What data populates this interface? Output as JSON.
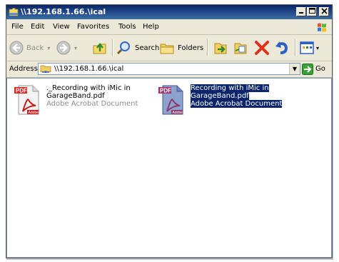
{
  "window": {
    "title": "\\\\192.168.1.66.\\ical",
    "controls": [
      "minimize",
      "maximize",
      "close"
    ]
  },
  "menubar": {
    "items": [
      "File",
      "Edit",
      "View",
      "Favorites",
      "Tools",
      "Help"
    ]
  },
  "toolbar": {
    "back_label": "Back",
    "search_label": "Search",
    "folders_label": "Folders",
    "icons": [
      "back-icon",
      "forward-icon",
      "up-folder-icon",
      "search-icon",
      "folders-icon",
      "move-to-icon",
      "copy-to-icon",
      "delete-icon",
      "undo-icon",
      "views-icon"
    ]
  },
  "address": {
    "label": "Address",
    "value": "\\\\192.168.1.66.\\ical",
    "go_label": "Go"
  },
  "files": [
    {
      "name_lines": [
        "._Recording with iMic in",
        "GarageBand.pdf"
      ],
      "type": "Adobe Acrobat Document",
      "selected": false
    },
    {
      "name_lines": [
        "Recording with iMic in",
        "GarageBand.pdf"
      ],
      "type": "Adobe Acrobat Document",
      "selected": true
    }
  ],
  "colors": {
    "titlebar": "#0a246a",
    "selection": "#0b246a",
    "chrome": "#ece9d8",
    "delete": "#e0301e"
  }
}
